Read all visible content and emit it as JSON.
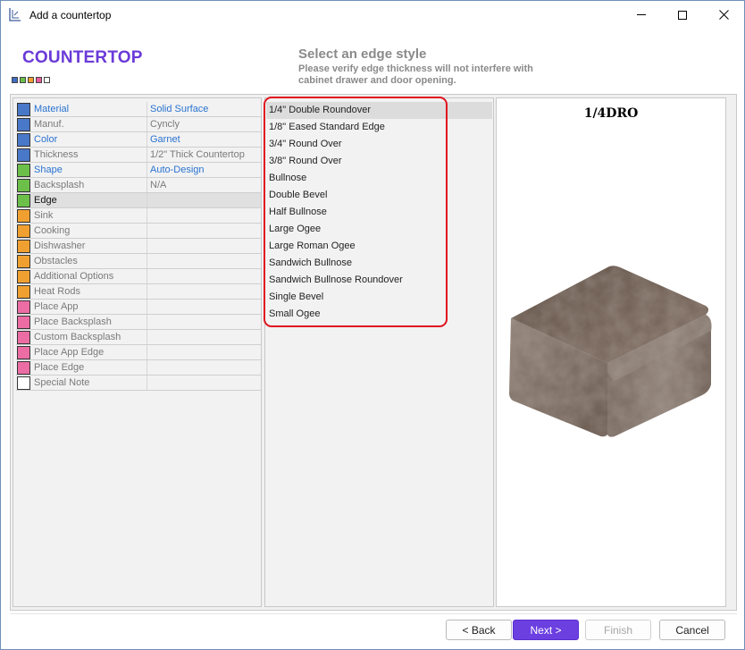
{
  "window": {
    "title": "Add a countertop"
  },
  "header": {
    "title": "COUNTERTOP",
    "heading": "Select an edge style",
    "subtext": "Please verify edge thickness will not interfere with cabinet drawer and door opening.",
    "step_colors": [
      "#3f6cc4",
      "#6cc04a",
      "#f0a030",
      "#e85c9a",
      "#ffffff"
    ]
  },
  "properties": [
    {
      "name": "Material",
      "value": "Solid Surface",
      "color": "#4a78c8",
      "name_style": "link",
      "value_style": "link"
    },
    {
      "name": "Manuf.",
      "value": "Cyncly",
      "color": "#4a78c8",
      "name_style": "gray",
      "value_style": "gray"
    },
    {
      "name": "Color",
      "value": "Garnet",
      "color": "#4a78c8",
      "name_style": "link",
      "value_style": "link"
    },
    {
      "name": "Thickness",
      "value": "1/2\" Thick Countertop",
      "color": "#4a78c8",
      "name_style": "gray",
      "value_style": "gray"
    },
    {
      "name": "Shape",
      "value": "Auto-Design",
      "color": "#6cc04a",
      "name_style": "link",
      "value_style": "link"
    },
    {
      "name": "Backsplash",
      "value": "N/A",
      "color": "#6cc04a",
      "name_style": "gray",
      "value_style": "gray"
    },
    {
      "name": "Edge",
      "value": "",
      "color": "#6cc04a",
      "name_style": "dark",
      "value_style": "gray"
    },
    {
      "name": "Sink",
      "value": "",
      "color": "#f0a030",
      "name_style": "gray",
      "value_style": "gray"
    },
    {
      "name": "Cooking",
      "value": "",
      "color": "#f0a030",
      "name_style": "gray",
      "value_style": "gray"
    },
    {
      "name": "Dishwasher",
      "value": "",
      "color": "#f0a030",
      "name_style": "gray",
      "value_style": "gray"
    },
    {
      "name": "Obstacles",
      "value": "",
      "color": "#f0a030",
      "name_style": "gray",
      "value_style": "gray"
    },
    {
      "name": "Additional Options",
      "value": "",
      "color": "#f0a030",
      "name_style": "gray",
      "value_style": "gray"
    },
    {
      "name": "Heat Rods",
      "value": "",
      "color": "#f0a030",
      "name_style": "gray",
      "value_style": "gray"
    },
    {
      "name": "Place App",
      "value": "",
      "color": "#ec6ca4",
      "name_style": "gray",
      "value_style": "gray"
    },
    {
      "name": "Place Backsplash",
      "value": "",
      "color": "#ec6ca4",
      "name_style": "gray",
      "value_style": "gray"
    },
    {
      "name": "Custom Backsplash",
      "value": "",
      "color": "#ec6ca4",
      "name_style": "gray",
      "value_style": "gray"
    },
    {
      "name": "Place App Edge",
      "value": "",
      "color": "#ec6ca4",
      "name_style": "gray",
      "value_style": "gray"
    },
    {
      "name": "Place Edge",
      "value": "",
      "color": "#ec6ca4",
      "name_style": "gray",
      "value_style": "gray"
    },
    {
      "name": "Special Note",
      "value": "",
      "color": "#ffffff",
      "name_style": "gray",
      "value_style": "gray"
    }
  ],
  "selected_property": "Edge",
  "edge_styles": [
    "1/4\" Double Roundover",
    "1/8\" Eased Standard Edge",
    "3/4\" Round Over",
    "3/8\" Round Over",
    "Bullnose",
    "Double Bevel",
    "Half Bullnose",
    "Large Ogee",
    "Large Roman Ogee",
    "Sandwich Bullnose",
    "Sandwich Bullnose Roundover",
    "Single Bevel",
    "Small Ogee"
  ],
  "selected_edge": "1/4\" Double Roundover",
  "preview": {
    "title": "1/4DRO"
  },
  "buttons": {
    "back": "< Back",
    "next": "Next >",
    "finish": "Finish",
    "cancel": "Cancel"
  }
}
